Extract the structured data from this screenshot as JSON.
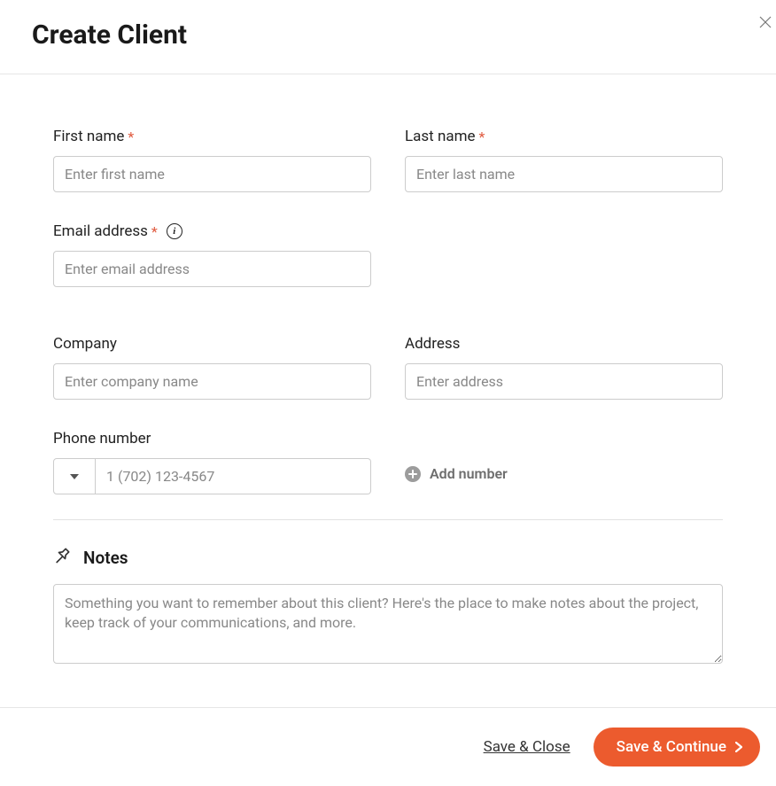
{
  "header": {
    "title": "Create Client"
  },
  "fields": {
    "first_name": {
      "label": "First name",
      "placeholder": "Enter first name",
      "value": "",
      "required": true
    },
    "last_name": {
      "label": "Last name",
      "placeholder": "Enter last name",
      "value": "",
      "required": true
    },
    "email": {
      "label": "Email address",
      "placeholder": "Enter email address",
      "value": "",
      "required": true
    },
    "company": {
      "label": "Company",
      "placeholder": "Enter company name",
      "value": ""
    },
    "address": {
      "label": "Address",
      "placeholder": "Enter address",
      "value": ""
    },
    "phone": {
      "label": "Phone number",
      "placeholder": "1 (702) 123-4567",
      "value": ""
    },
    "add_number_label": "Add number"
  },
  "notes": {
    "heading": "Notes",
    "placeholder": "Something you want to remember about this client? Here's the place to make notes about the project, keep track of your communications, and more.",
    "value": ""
  },
  "footer": {
    "save_close": "Save & Close",
    "save_continue": "Save & Continue"
  },
  "symbols": {
    "required": "*",
    "info": "i"
  }
}
